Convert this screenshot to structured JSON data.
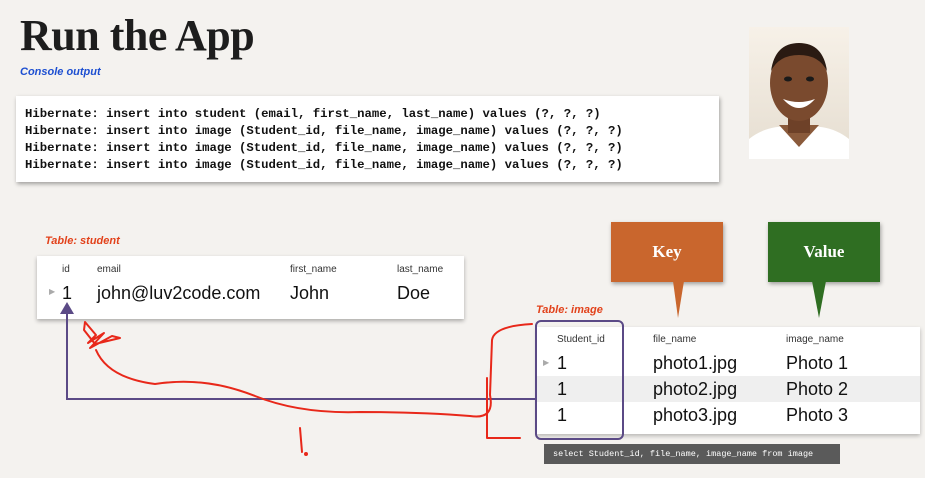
{
  "title": "Run the App",
  "subtitle": "Console output",
  "console": {
    "lines": [
      "Hibernate: insert into student (email, first_name, last_name) values (?, ?, ?)",
      "Hibernate: insert into image (Student_id, file_name, image_name) values (?, ?, ?)",
      "Hibernate: insert into image (Student_id, file_name, image_name) values (?, ?, ?)",
      "Hibernate: insert into image (Student_id, file_name, image_name) values (?, ?, ?)"
    ]
  },
  "photo": {
    "alt": "portrait-photo"
  },
  "student_table": {
    "label": "Table: student",
    "columns": [
      "id",
      "email",
      "first_name",
      "last_name"
    ],
    "rows": [
      [
        "1",
        "john@luv2code.com",
        "John",
        "Doe"
      ]
    ]
  },
  "image_table": {
    "label": "Table: image",
    "columns": [
      "Student_id",
      "file_name",
      "image_name"
    ],
    "rows": [
      [
        "1",
        "photo1.jpg",
        "Photo 1"
      ],
      [
        "1",
        "photo2.jpg",
        "Photo 2"
      ],
      [
        "1",
        "photo3.jpg",
        "Photo 3"
      ]
    ]
  },
  "callouts": {
    "key": {
      "label": "Key",
      "color": "#c9662d"
    },
    "value": {
      "label": "Value",
      "color": "#2f6e22"
    }
  },
  "sql": "select Student_id, file_name, image_name from image",
  "annotation": "1.",
  "colors": {
    "accent_blue": "#1d4fd1",
    "label_red": "#e2421b",
    "link_purple": "#5b4a86",
    "ink_red": "#e8281a"
  }
}
